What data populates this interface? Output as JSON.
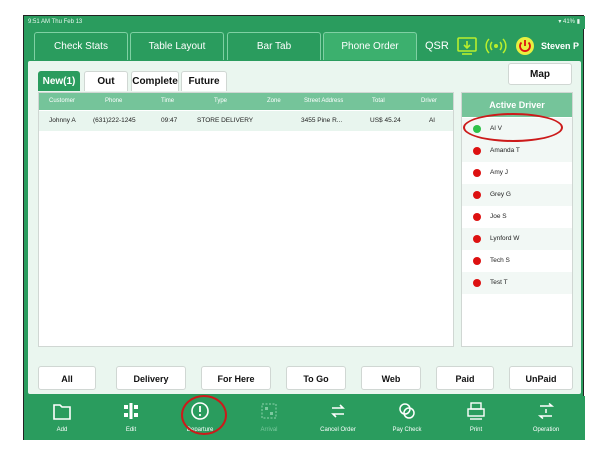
{
  "status_bar": {
    "time_date": "9:51 AM  Thu Feb 13",
    "battery": "41%"
  },
  "nav": {
    "tabs": [
      "Check Stats",
      "Table Layout",
      "Bar Tab",
      "Phone Order"
    ],
    "active_tab": "Phone Order",
    "qsr": "QSR",
    "user": "Steven P",
    "icons": [
      "monitor-download-icon",
      "broadcast-icon",
      "power-icon"
    ]
  },
  "order_tabs": [
    "New(1)",
    "Out",
    "Complete",
    "Future"
  ],
  "map_label": "Map",
  "table": {
    "headers": [
      "Customer",
      "Phone",
      "Time",
      "Type",
      "Zone",
      "Street Address",
      "Total",
      "Driver"
    ],
    "rows": [
      [
        "Johnny A",
        "(631)222-1245",
        "09:47",
        "STORE DELIVERY",
        "",
        "3455   Pine R...",
        "US$ 45.24",
        "Al"
      ]
    ]
  },
  "drivers": {
    "title": "Active Driver",
    "items": [
      {
        "name": "Al V",
        "status": "available"
      },
      {
        "name": "Amanda T",
        "status": "busy"
      },
      {
        "name": "Amy J",
        "status": "busy"
      },
      {
        "name": "Grey G",
        "status": "busy"
      },
      {
        "name": "Joe S",
        "status": "busy"
      },
      {
        "name": "Lynford W",
        "status": "busy"
      },
      {
        "name": "Tech S",
        "status": "busy"
      },
      {
        "name": "Test T",
        "status": "busy"
      }
    ]
  },
  "filters": [
    "All",
    "Delivery",
    "For Here",
    "To Go",
    "Web",
    "Paid",
    "UnPaid"
  ],
  "toolbar": [
    {
      "label": "Add",
      "icon": "folder-icon"
    },
    {
      "label": "Edit",
      "icon": "edit-grid-icon"
    },
    {
      "label": "Departure",
      "icon": "alert-circle-icon"
    },
    {
      "label": "Arrival",
      "icon": "qr-code-icon",
      "disabled": true
    },
    {
      "label": "Cancel Order",
      "icon": "swap-arrows-icon"
    },
    {
      "label": "Pay Check",
      "icon": "coins-icon"
    },
    {
      "label": "Print",
      "icon": "printer-icon"
    },
    {
      "label": "Operation",
      "icon": "operation-arrows-icon"
    }
  ],
  "colors": {
    "brand": "#2a9c5e",
    "header_green": "#75c49a",
    "available_dot": "#2fc24a",
    "busy_dot": "#dd1111",
    "annotation_red": "#cc1a1a"
  }
}
